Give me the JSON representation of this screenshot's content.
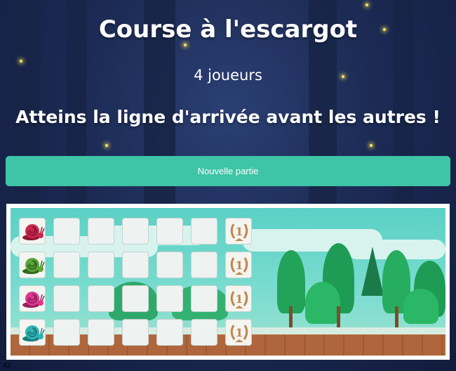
{
  "title": "Course à l'escargot",
  "players": "4 joueurs",
  "goal": "Atteins la ligne d'arrivée avant les autres !",
  "new_game_label": "Nouvelle partie",
  "counter": "42",
  "board": {
    "rows": [
      {
        "snail_color": "#c9274f",
        "snail_shade": "#8f1533",
        "position": 0
      },
      {
        "snail_color": "#5fa33a",
        "snail_shade": "#2e6a1e",
        "position": 0
      },
      {
        "snail_color": "#d93a8e",
        "snail_shade": "#9b1f60",
        "position": 0
      },
      {
        "snail_color": "#2fb3b3",
        "snail_shade": "#1a7f80",
        "position": 0
      }
    ],
    "track_length": 5,
    "finish_icon": "trophy-icon",
    "finish_label": "1"
  },
  "colors": {
    "accent": "#3ec4a6",
    "trophy": "#c0864a"
  }
}
